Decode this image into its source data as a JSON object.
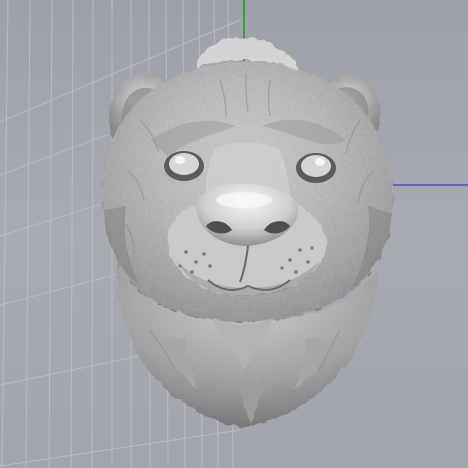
{
  "viewport": {
    "background": "#a5a9af",
    "grid_color": "#b9bcc1",
    "axis_green": "#3f9b3f",
    "axis_blue": "#4a4ac8"
  },
  "model": {
    "type": "sculpted animal head (bear/otter bust)",
    "material_color": "#c9c9c9",
    "shadow_color": "#6e6e6e",
    "highlight_color": "#f2f2f2"
  }
}
